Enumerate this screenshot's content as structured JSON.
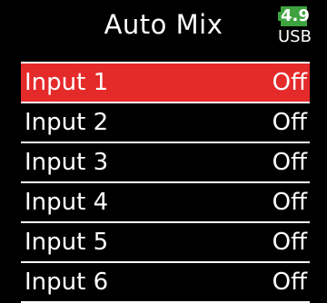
{
  "screen": {
    "title": "Auto Mix"
  },
  "battery": {
    "level_text": "4.9",
    "source_text": "USB",
    "color": "#3ea33e"
  },
  "colors": {
    "background": "#000000",
    "selection": "#e52a2a",
    "text": "#ffffff"
  },
  "inputs": [
    {
      "label": "Input 1",
      "value": "Off",
      "selected": true
    },
    {
      "label": "Input 2",
      "value": "Off",
      "selected": false
    },
    {
      "label": "Input 3",
      "value": "Off",
      "selected": false
    },
    {
      "label": "Input 4",
      "value": "Off",
      "selected": false
    },
    {
      "label": "Input 5",
      "value": "Off",
      "selected": false
    },
    {
      "label": "Input 6",
      "value": "Off",
      "selected": false
    }
  ]
}
